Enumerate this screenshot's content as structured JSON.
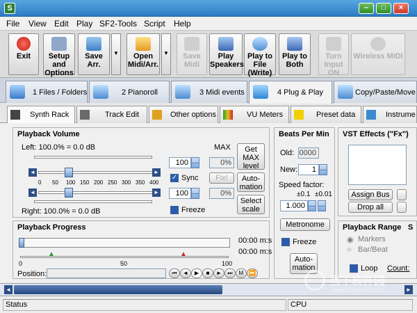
{
  "window": {
    "app_icon_glyph": "S",
    "min_glyph": "–",
    "max_glyph": "□",
    "close_glyph": "×"
  },
  "menu": [
    "File",
    "View",
    "Edit",
    "Play",
    "SF2-Tools",
    "Script",
    "Help"
  ],
  "toolbar": {
    "exit": "Exit",
    "setup": "Setup and Options",
    "save": "Save Arr.",
    "open": "Open Midi/Arr.",
    "disabled1": "Save Midi",
    "play_speakers": "Play Speakers",
    "play_to_file": "Play to File (Write)",
    "play_to_both": "Play to Both",
    "turn_input": "Turn Input ON",
    "wireless": "Wireless MIDI"
  },
  "main_tabs": [
    "1 Files / Folders",
    "2 Pianoroll",
    "3 Midi events",
    "4 Plug & Play",
    "Copy/Paste/Move"
  ],
  "sub_tabs": [
    "Synth Rack",
    "Track Edit",
    "Other options",
    "VU Meters",
    "Preset data",
    "Instrume"
  ],
  "volume": {
    "title": "Playback Volume",
    "left_label": "Left: 100.0% = 0.0 dB",
    "right_label": "Right: 100.0% = 0.0 dB",
    "max": "MAX",
    "left_value": "100",
    "right_value": "100",
    "left_pct": "0%",
    "right_pct": "0%",
    "sync": "Sync",
    "fix": "Fix!",
    "freeze": "Freeze",
    "get_max": "Get MAX level",
    "automation": "Auto-mation",
    "select_scale": "Select scale",
    "scale_ticks": [
      "0",
      "50",
      "100",
      "150",
      "200",
      "250",
      "300",
      "350",
      "400"
    ]
  },
  "bpm": {
    "title": "Beats Per Min",
    "old_label": "Old:",
    "old_value": "0000",
    "new_label": "New:",
    "new_value": "1",
    "speed_label": "Speed factor:",
    "speed_hint_a": "±0.1",
    "speed_hint_b": "±0.01",
    "speed_value": "1.000",
    "metronome": "Metronome",
    "freeze": "Freeze",
    "automation": "Auto-mation"
  },
  "vst": {
    "title": "VST Effects (\"Fx\")",
    "assign_bus": "Assign Bus",
    "drop_all": "Drop all"
  },
  "progress": {
    "title": "Playback Progress",
    "time1": "00:00 m:s",
    "time2": "00:00 m:s",
    "scale_start": "0",
    "scale_mid": "50",
    "scale_end": "100",
    "position_label": "Position:"
  },
  "range": {
    "title": "Playback Range",
    "markers": "Markers",
    "barbeat": "Bar/Beat",
    "loop": "Loop",
    "count": "Count:",
    "extra_s": "S"
  },
  "status": {
    "left": "Status",
    "cpu": "CPU"
  },
  "watermark": {
    "text": "当下软件园",
    "url": "www.downxia.com"
  }
}
